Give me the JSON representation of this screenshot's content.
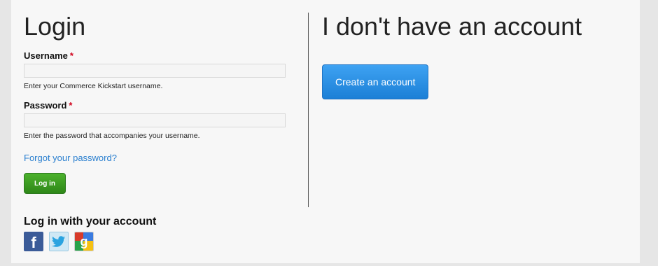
{
  "login": {
    "title": "Login",
    "username_label": "Username",
    "username_required": "*",
    "username_value": "",
    "username_help": "Enter your Commerce Kickstart username.",
    "password_label": "Password",
    "password_required": "*",
    "password_value": "",
    "password_help": "Enter the password that accompanies your username.",
    "forgot_link": "Forgot your password?",
    "submit_label": "Log in"
  },
  "social": {
    "title": "Log in with your account",
    "providers": [
      {
        "name": "facebook",
        "icon": "facebook-icon",
        "glyph": "f",
        "color": "#3b5b98"
      },
      {
        "name": "twitter",
        "icon": "twitter-icon",
        "color": "#cfe8f5"
      },
      {
        "name": "google",
        "icon": "google-icon",
        "glyph": "g",
        "color": "#ffffff"
      }
    ]
  },
  "register": {
    "title": "I don't have an account",
    "button_label": "Create an account"
  },
  "colors": {
    "link": "#2a7fcf",
    "login_button": "#3d9e22",
    "create_button": "#2b8fe6",
    "required": "#d0021b"
  }
}
